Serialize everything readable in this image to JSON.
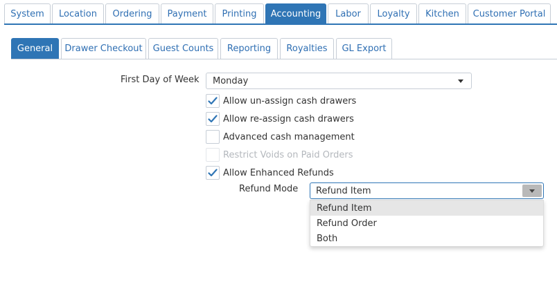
{
  "top_tabs": [
    {
      "label": "System"
    },
    {
      "label": "Location"
    },
    {
      "label": "Ordering"
    },
    {
      "label": "Payment"
    },
    {
      "label": "Printing"
    },
    {
      "label": "Accounting",
      "active": true
    },
    {
      "label": "Labor"
    },
    {
      "label": "Loyalty"
    },
    {
      "label": "Kitchen"
    },
    {
      "label": "Customer Portal"
    }
  ],
  "sub_tabs": [
    {
      "label": "General",
      "active": true
    },
    {
      "label": "Drawer Checkout"
    },
    {
      "label": "Guest Counts"
    },
    {
      "label": "Reporting"
    },
    {
      "label": "Royalties"
    },
    {
      "label": "GL Export"
    }
  ],
  "form": {
    "first_day_label": "First Day of Week",
    "first_day_value": "Monday",
    "checkboxes": [
      {
        "label": "Allow un-assign cash drawers",
        "checked": true,
        "disabled": false
      },
      {
        "label": "Allow re-assign cash drawers",
        "checked": true,
        "disabled": false
      },
      {
        "label": "Advanced cash management",
        "checked": false,
        "disabled": false
      },
      {
        "label": "Restrict Voids on Paid Orders",
        "checked": false,
        "disabled": true
      },
      {
        "label": "Allow Enhanced Refunds",
        "checked": true,
        "disabled": false
      }
    ],
    "refund_mode_label": "Refund Mode",
    "refund_mode_value": "Refund Item",
    "refund_mode_options": [
      {
        "label": "Refund Item",
        "selected": true
      },
      {
        "label": "Refund Order",
        "selected": false
      },
      {
        "label": "Both",
        "selected": false
      }
    ]
  },
  "colors": {
    "accent": "#2f75b5",
    "tab_text": "#2f6fb3",
    "border": "#c6cdd6",
    "disabled_text": "#b4b8bd",
    "check_color": "#2f75b5"
  }
}
